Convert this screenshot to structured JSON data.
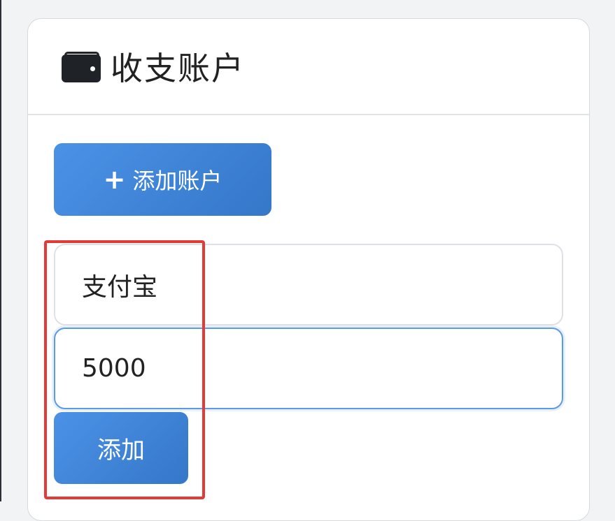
{
  "card": {
    "title": "收支账户",
    "icon": "wallet-icon"
  },
  "toolbar": {
    "add_account_label": "添加账户",
    "add_icon": "plus-icon"
  },
  "form": {
    "name_value": "支付宝",
    "amount_value": "5000",
    "submit_label": "添加"
  },
  "colors": {
    "accent": "#3d85d8",
    "highlight": "#e53935"
  }
}
